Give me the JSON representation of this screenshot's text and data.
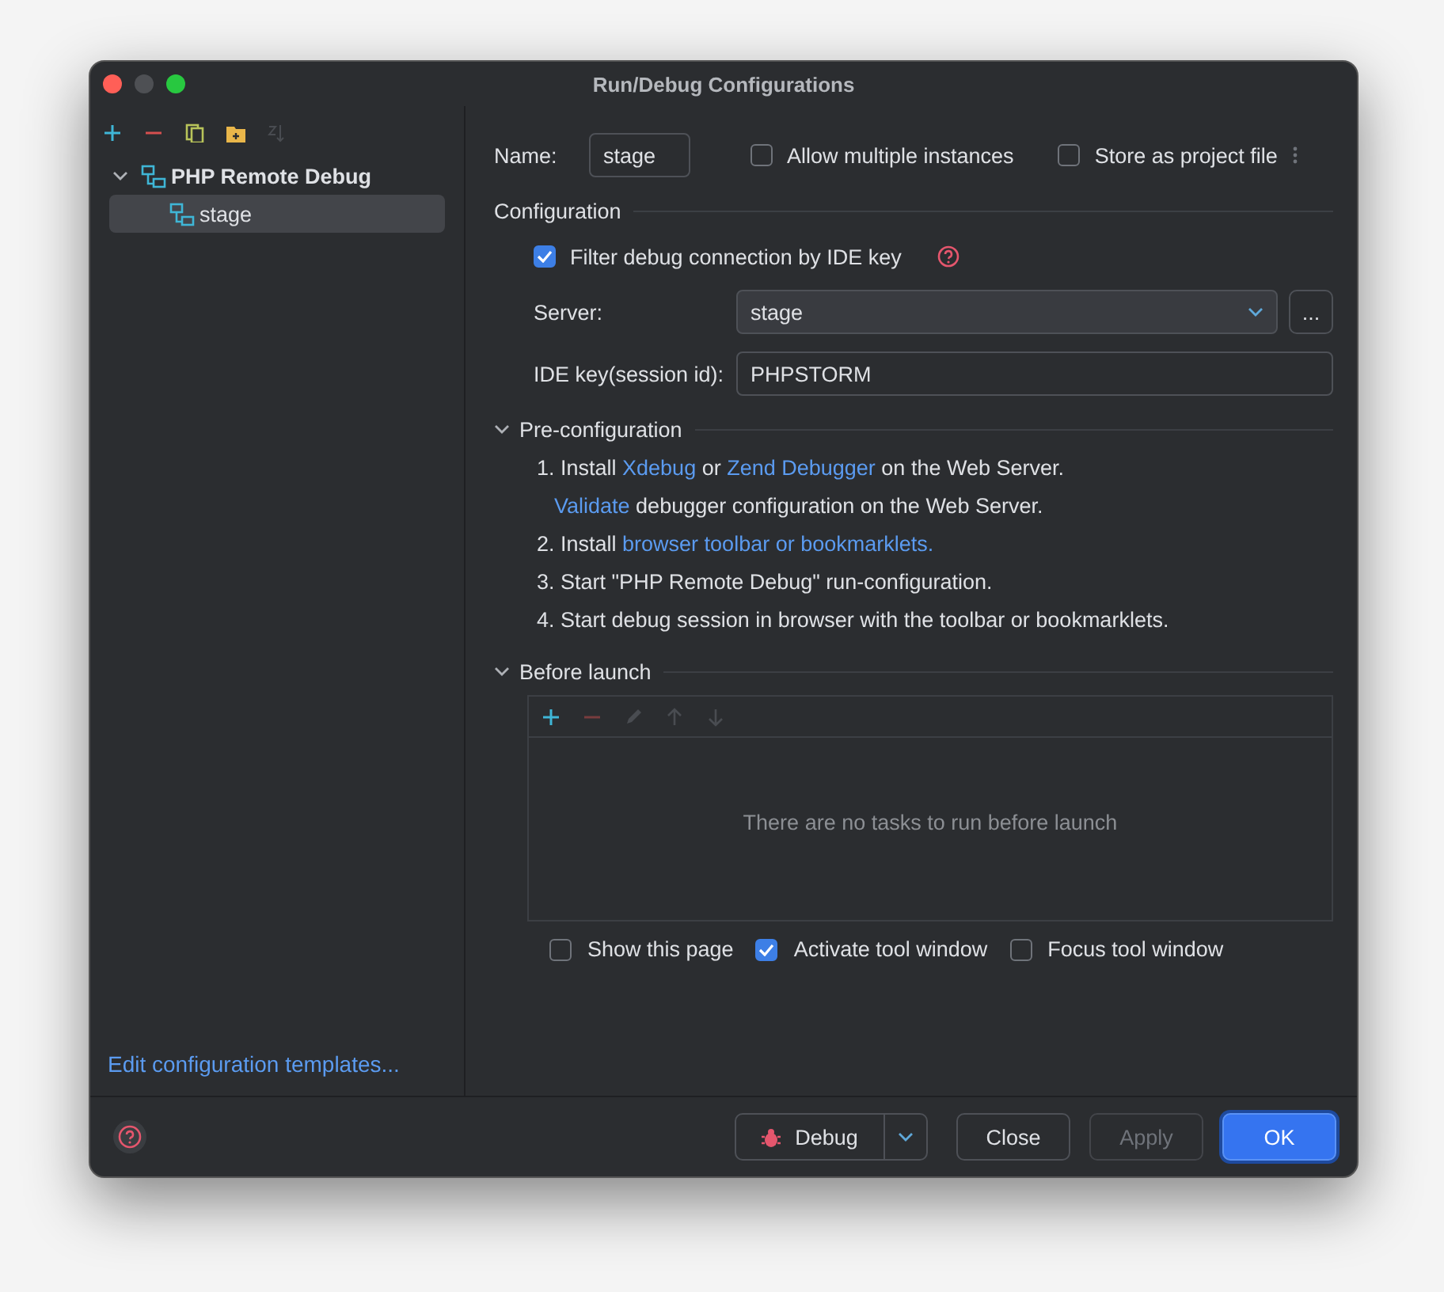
{
  "window": {
    "title": "Run/Debug Configurations"
  },
  "sidebar_toolbar": [
    {
      "kind": "add",
      "disabled": false
    },
    {
      "kind": "remove",
      "disabled": false
    },
    {
      "kind": "copy",
      "disabled": false
    },
    {
      "kind": "folder",
      "disabled": false
    },
    {
      "kind": "sort",
      "disabled": true
    }
  ],
  "tree": [
    {
      "label": "PHP Remote Debug",
      "expanded": true,
      "selected": false,
      "children": [
        {
          "label": "stage",
          "selected": true
        }
      ]
    }
  ],
  "templates_link": "Edit configuration templates...",
  "name_field": {
    "label": "Name:",
    "value": "stage"
  },
  "top_options": [
    {
      "label": "Allow multiple instances",
      "checked": false
    },
    {
      "label": "Store as project file",
      "checked": false
    }
  ],
  "configuration": {
    "title": "Configuration",
    "filter": {
      "label": "Filter debug connection by IDE key",
      "checked": true
    },
    "server": {
      "label": "Server:",
      "value": "stage",
      "browse": "..."
    },
    "ide_key": {
      "label": "IDE key(session id):",
      "value": "PHPSTORM"
    }
  },
  "pre_configuration": {
    "title": "Pre-configuration",
    "expanded": true,
    "steps": [
      [
        {
          "kind": "text",
          "text": "1. Install "
        },
        {
          "kind": "link",
          "text": "Xdebug"
        },
        {
          "kind": "text",
          "text": " or "
        },
        {
          "kind": "link",
          "text": "Zend Debugger"
        },
        {
          "kind": "text",
          "text": " on the Web Server."
        }
      ],
      [
        {
          "kind": "link",
          "text": "Validate"
        },
        {
          "kind": "text",
          "text": " debugger configuration on the Web Server."
        }
      ],
      [
        {
          "kind": "text",
          "text": "2. Install "
        },
        {
          "kind": "link",
          "text": "browser toolbar or bookmarklets."
        }
      ],
      [
        {
          "kind": "text",
          "text": "3. Start \"PHP Remote Debug\" run-configuration."
        }
      ],
      [
        {
          "kind": "text",
          "text": "4. Start debug session in browser with the toolbar or bookmarklets."
        }
      ]
    ]
  },
  "before_launch": {
    "title": "Before launch",
    "expanded": true,
    "toolbar": [
      {
        "kind": "add",
        "disabled": false
      },
      {
        "kind": "remove",
        "disabled": true
      },
      {
        "kind": "edit",
        "disabled": true
      },
      {
        "kind": "up",
        "disabled": true
      },
      {
        "kind": "down",
        "disabled": true
      }
    ],
    "empty_text": "There are no tasks to run before launch",
    "options": [
      {
        "label": "Show this page",
        "checked": false
      },
      {
        "label": "Activate tool window",
        "checked": true
      },
      {
        "label": "Focus tool window",
        "checked": false
      }
    ]
  },
  "footer": {
    "buttons": [
      {
        "kind": "split",
        "label": "Debug"
      },
      {
        "kind": "plain",
        "label": "Close",
        "disabled": false,
        "default": false
      },
      {
        "kind": "plain",
        "label": "Apply",
        "disabled": true,
        "default": false
      },
      {
        "kind": "plain",
        "label": "OK",
        "disabled": false,
        "default": true
      }
    ]
  }
}
